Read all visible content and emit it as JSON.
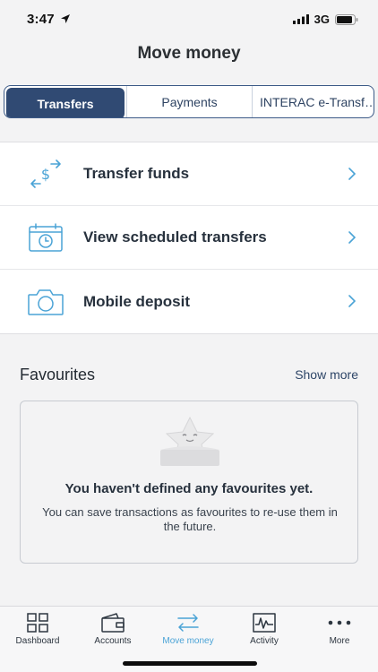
{
  "status_bar": {
    "time": "3:47",
    "network": "3G"
  },
  "nav": {
    "title": "Move money"
  },
  "segments": [
    {
      "label": "Transfers",
      "active": true
    },
    {
      "label": "Payments",
      "active": false
    },
    {
      "label": "INTERAC e-Transf…",
      "active": false
    }
  ],
  "menu": [
    {
      "label": "Transfer funds",
      "icon": "transfer-dollar-icon"
    },
    {
      "label": "View scheduled transfers",
      "icon": "calendar-clock-icon"
    },
    {
      "label": "Mobile deposit",
      "icon": "camera-icon"
    }
  ],
  "favourites": {
    "title": "Favourites",
    "show_more": "Show more",
    "empty_title": "You haven't defined any favourites yet.",
    "empty_desc": "You can save transactions as favourites to re-use them in the future."
  },
  "tabs": [
    {
      "label": "Dashboard",
      "icon": "dashboard-icon",
      "active": false
    },
    {
      "label": "Accounts",
      "icon": "wallet-icon",
      "active": false
    },
    {
      "label": "Move money",
      "icon": "transfer-arrows-icon",
      "active": true
    },
    {
      "label": "Activity",
      "icon": "activity-chart-icon",
      "active": false
    },
    {
      "label": "More",
      "icon": "more-dots-icon",
      "active": false
    }
  ],
  "colors": {
    "accent": "#4aa3d6",
    "primary": "#304a73",
    "background": "#f3f3f4"
  }
}
